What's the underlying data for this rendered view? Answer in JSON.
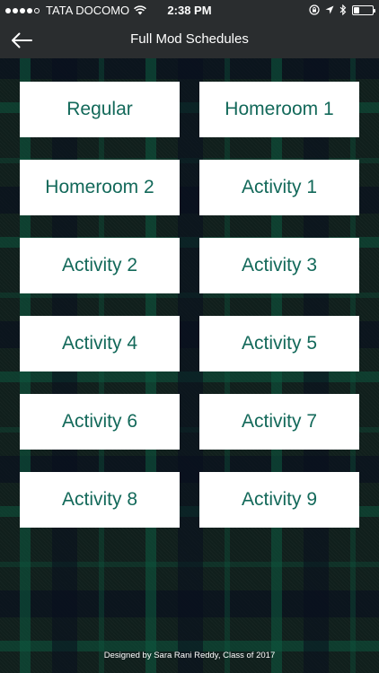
{
  "status_bar": {
    "carrier": "TATA DOCOMO",
    "time": "2:38 PM",
    "signal_bars_filled": 4,
    "signal_bars_total": 5,
    "battery_level": 0.3,
    "icons": [
      "wifi-icon",
      "lock-rotation-icon",
      "location-arrow-icon",
      "bluetooth-icon",
      "battery-icon"
    ]
  },
  "nav": {
    "title": "Full Mod Schedules",
    "back_icon": "back-arrow-icon"
  },
  "schedules": [
    "Regular",
    "Homeroom 1",
    "Homeroom 2",
    "Activity 1",
    "Activity 2",
    "Activity 3",
    "Activity 4",
    "Activity 5",
    "Activity 6",
    "Activity 7",
    "Activity 8",
    "Activity 9"
  ],
  "footer": {
    "credit": "Designed by Sara Rani Reddy, Class of 2017"
  },
  "colors": {
    "bar_background": "#2a2d2f",
    "button_background": "#ffffff",
    "button_text": "#13695a",
    "plaid_base": "#101f1c"
  }
}
